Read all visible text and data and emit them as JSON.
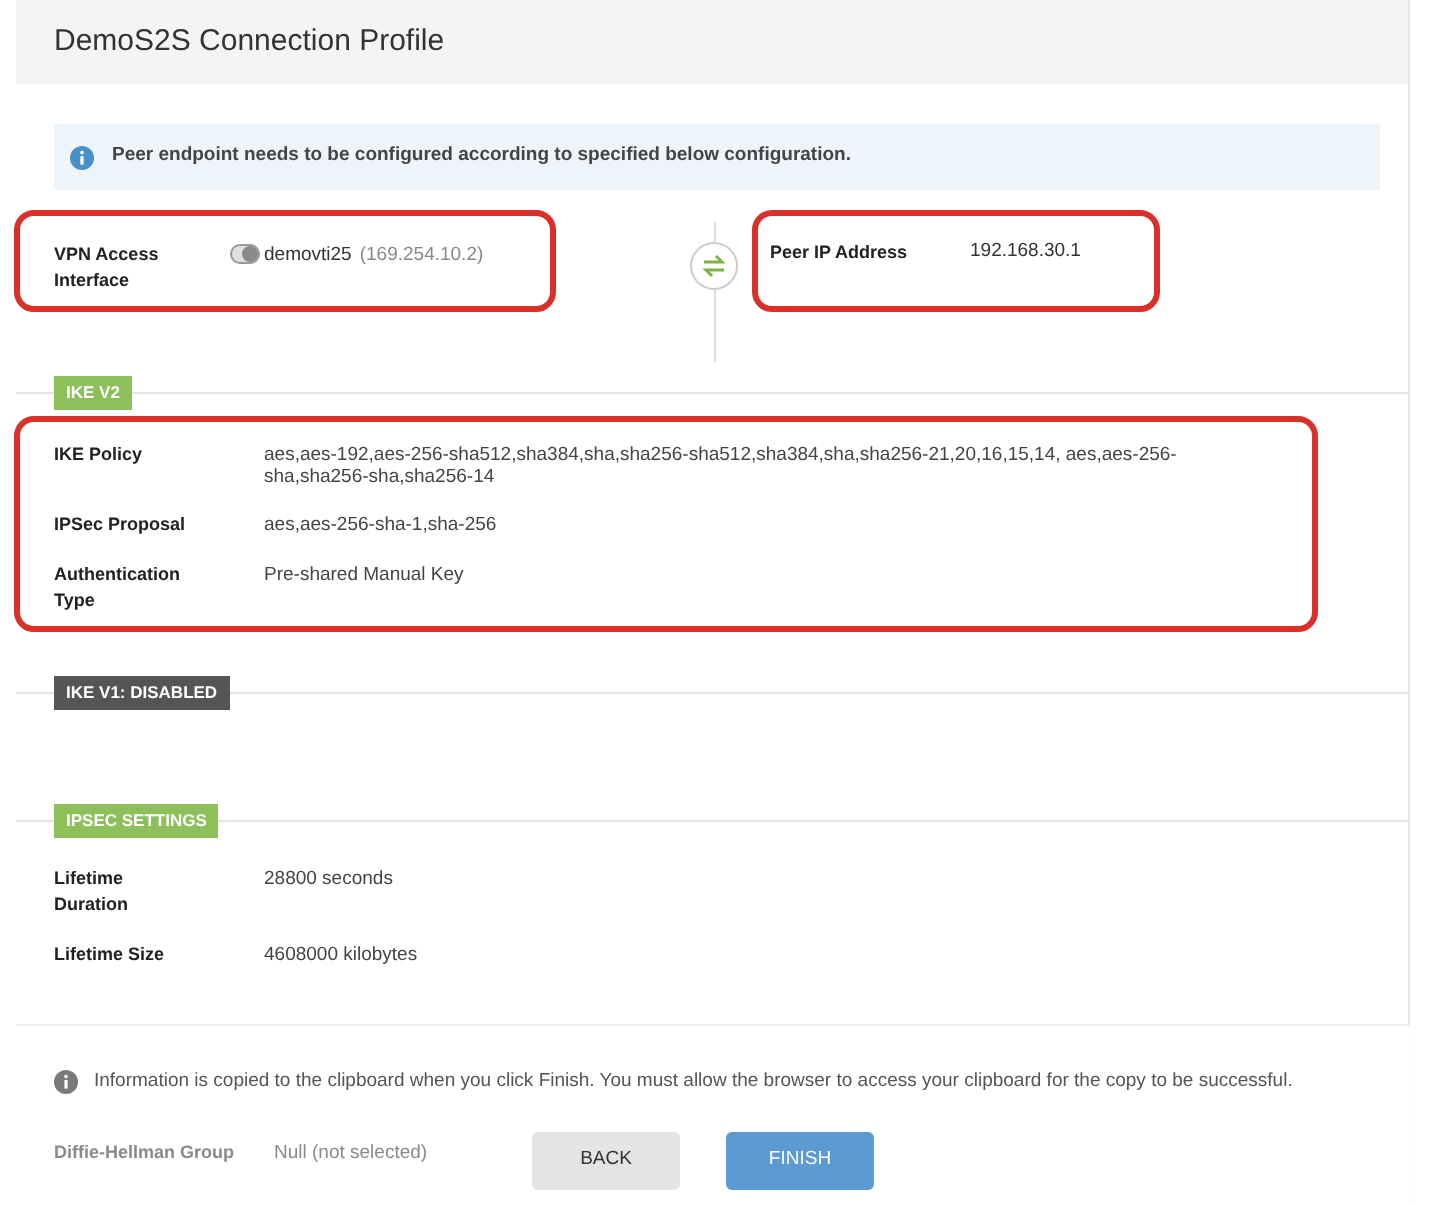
{
  "title": "DemoS2S Connection Profile",
  "notice": "Peer endpoint needs to be configured according to specified below configuration.",
  "endpoints": {
    "local": {
      "label": "VPN Access Interface",
      "interface": "demovti25",
      "address": "(169.254.10.2)",
      "highlighted": true
    },
    "peer": {
      "label": "Peer IP Address",
      "value": "192.168.30.1",
      "highlighted": true
    }
  },
  "sections": [
    {
      "badge": "IKE V2",
      "kind": "enabled",
      "highlighted": true,
      "rows": [
        {
          "label": "IKE Policy",
          "value": "aes,aes-192,aes-256-sha512,sha384,sha,sha256-sha512,sha384,sha,sha256-21,20,16,15,14, aes,aes-256-sha,sha256-sha,sha256-14"
        },
        {
          "label": "IPSec Proposal",
          "value": "aes,aes-256-sha-1,sha-256"
        },
        {
          "label": "Authentication Type",
          "value": "Pre-shared Manual Key"
        }
      ]
    },
    {
      "badge": "IKE V1: DISABLED",
      "kind": "disabled"
    },
    {
      "badge": "IPSEC SETTINGS",
      "kind": "enabled",
      "rows": [
        {
          "label": "Lifetime Duration",
          "value": "28800 seconds"
        },
        {
          "label": "Lifetime Size",
          "value": "4608000 kilobytes"
        }
      ]
    }
  ],
  "covered_row": {
    "label": "Diffie-Hellman Group",
    "value": "Null (not selected)"
  },
  "footer": {
    "note": "Information is copied to the clipboard when you click Finish. You must allow the browser to access your clipboard for the copy to be successful.",
    "buttons": [
      {
        "label": "BACK",
        "kind": "secondary"
      },
      {
        "label": "FINISH",
        "kind": "primary"
      }
    ]
  }
}
